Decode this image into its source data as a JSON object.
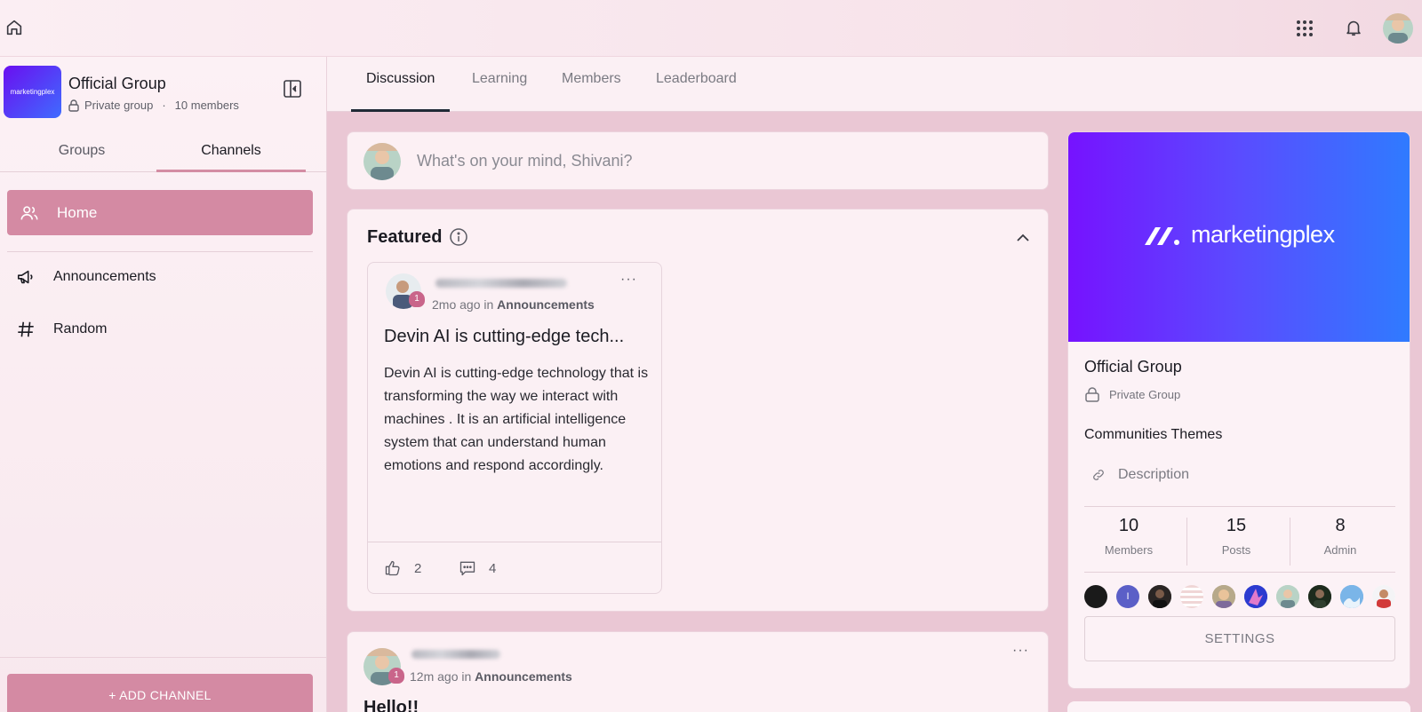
{
  "top_bar": {
    "icons": [
      "home-icon",
      "apps-grid-icon",
      "bell-icon",
      "user-avatar"
    ]
  },
  "sidebar": {
    "group_name": "Official Group",
    "privacy": "Private group",
    "separator": "·",
    "member_count": "10 members",
    "logo_text": "marketingplex",
    "tabs": [
      {
        "label": "Groups",
        "active": false
      },
      {
        "label": "Channels",
        "active": true
      }
    ],
    "channels": [
      {
        "label": "Home",
        "icon": "users-icon",
        "active": true
      },
      {
        "label": "Announcements",
        "icon": "megaphone-icon",
        "active": false
      },
      {
        "label": "Random",
        "icon": "hash-icon",
        "active": false
      }
    ],
    "add_channel_label": "+ ADD CHANNEL"
  },
  "main": {
    "tabs": [
      {
        "label": "Discussion",
        "active": true
      },
      {
        "label": "Learning",
        "active": false
      },
      {
        "label": "Members",
        "active": false
      },
      {
        "label": "Leaderboard",
        "active": false
      }
    ],
    "composer_placeholder": "What's on your mind, Shivani?",
    "featured": {
      "title": "Featured",
      "post": {
        "badge": "1",
        "time": "2mo ago",
        "in_text": "in",
        "channel": "Announcements",
        "heading": "Devin AI is cutting-edge tech...",
        "body": "Devin AI is cutting-edge technology that is transforming the way we interact with machines . It is an artificial intelligence system that can understand human emotions and respond accordingly.",
        "likes": "2",
        "comments": "4"
      }
    },
    "second_post": {
      "badge": "1",
      "time": "12m ago",
      "in_text": "in",
      "channel": "Announcements",
      "heading": "Hello!!"
    }
  },
  "info_panel": {
    "banner_text": "marketingplex",
    "title": "Official Group",
    "privacy": "Private Group",
    "themes": "Communities Themes",
    "description_label": "Description",
    "stats": [
      {
        "value": "10",
        "label": "Members"
      },
      {
        "value": "15",
        "label": "Posts"
      },
      {
        "value": "8",
        "label": "Admin"
      }
    ],
    "member_initial": "I",
    "settings_label": "SETTINGS"
  },
  "colors": {
    "accent": "#d48aa3",
    "banner_start": "#7612ff",
    "banner_end": "#2f7bff",
    "content_bg": "#eac7d4"
  }
}
